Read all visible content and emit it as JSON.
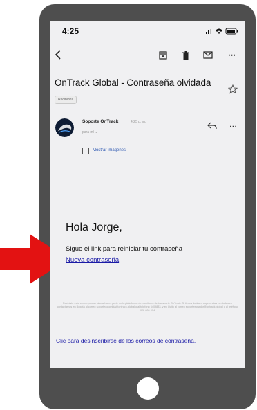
{
  "status_bar": {
    "time": "4:25"
  },
  "toolbar": {
    "icons": [
      "back-icon",
      "archive-icon",
      "trash-icon",
      "mail-icon",
      "more-icon"
    ]
  },
  "email": {
    "subject": "OnTrack Global - Contraseña olvidada",
    "label": "Recibidos",
    "sender": {
      "name": "Soporte OnTrack",
      "time": "4:25 p. m.",
      "to": "para mí"
    },
    "show_images": "Mostrar imágenes",
    "body": {
      "greeting": "Hola Jorge,",
      "instruction": "Sigue el link para reiniciar tu contraseña",
      "reset_link": "Nueva contraseña",
      "footer": "Recibiste este correo porque ahora haces parte de la plataforma de monitoreo de transporte OnTrack. Si tienes dudas o sugerencias no dudes en contactarnos en Bogotá al correo soportecolombia@ontrack.global o al teléfono 6409833, y en Quito al correo soporteecuador@ontrack.global o al teléfono 022 800 074",
      "unsubscribe": "Clic para desinscribirse de los correos de contraseña."
    }
  },
  "colors": {
    "arrow": "#e31212",
    "phone": "#4e4e4e",
    "screen": "#f0f0f2",
    "link": "#1a1aa6"
  }
}
